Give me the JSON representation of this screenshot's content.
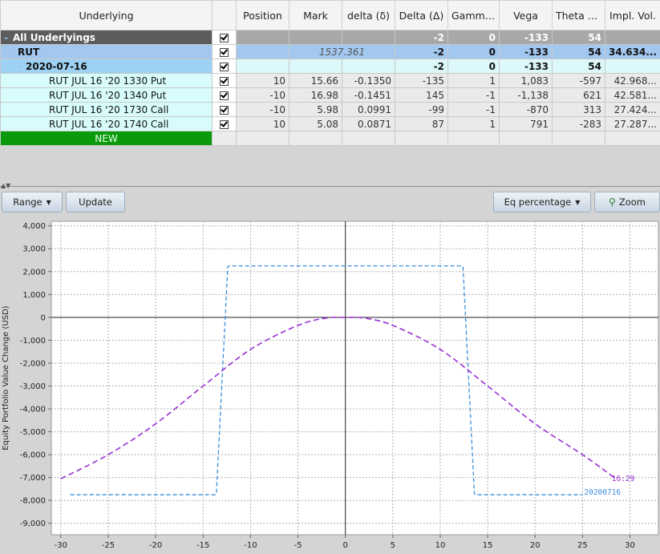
{
  "columns": [
    "Underlying",
    "",
    "Position",
    "Mark",
    "delta (δ)",
    "Delta (Δ)",
    "Gamma...",
    "Vega",
    "Theta (Θ)",
    "Impl. Vol."
  ],
  "all_row": {
    "label": "All Underlyings",
    "delta_cap": "-2",
    "gamma": "0",
    "vega": "-133",
    "theta": "54"
  },
  "rut_row": {
    "label": "RUT",
    "mark": "1537.361",
    "delta_cap": "-2",
    "gamma": "0",
    "vega": "-133",
    "theta": "54",
    "iv": "34.634..."
  },
  "date_row": {
    "label": "2020-07-16",
    "delta_cap": "-2",
    "gamma": "0",
    "vega": "-133",
    "theta": "54"
  },
  "legs": [
    {
      "name": "RUT JUL 16 '20 1330 Put",
      "position": "10",
      "mark": "15.66",
      "delta": "-0.1350",
      "delta_cap": "-135",
      "gamma": "1",
      "vega": "1,083",
      "theta": "-597",
      "iv": "42.968..."
    },
    {
      "name": "RUT JUL 16 '20 1340 Put",
      "position": "-10",
      "mark": "16.98",
      "delta": "-0.1451",
      "delta_cap": "145",
      "gamma": "-1",
      "vega": "-1,138",
      "theta": "621",
      "iv": "42.581..."
    },
    {
      "name": "RUT JUL 16 '20 1730 Call",
      "position": "-10",
      "mark": "5.98",
      "delta": "0.0991",
      "delta_cap": "-99",
      "gamma": "-1",
      "vega": "-870",
      "theta": "313",
      "iv": "27.424..."
    },
    {
      "name": "RUT JUL 16 '20 1740 Call",
      "position": "10",
      "mark": "5.08",
      "delta": "0.0871",
      "delta_cap": "87",
      "gamma": "1",
      "vega": "791",
      "theta": "-283",
      "iv": "27.287..."
    }
  ],
  "new_row_label": "NEW",
  "toolbar": {
    "range": "Range",
    "update": "Update",
    "eq": "Eq percentage",
    "zoom": "Zoom"
  },
  "chart_data": {
    "type": "line",
    "ylabel": "Equity Portfolio Value Change (USD)",
    "xlim": [
      -31,
      33
    ],
    "ylim": [
      -9500,
      4200
    ],
    "xticks": [
      -30,
      -25,
      -20,
      -15,
      -10,
      -5,
      0,
      5,
      10,
      15,
      20,
      25,
      30
    ],
    "yticks": [
      4000,
      3000,
      2000,
      1000,
      0,
      -1000,
      -2000,
      -3000,
      -4000,
      -5000,
      -6000,
      -7000,
      -8000,
      -9000
    ],
    "ytick_labels": [
      "4,000",
      "3,000",
      "2,000",
      "1,000",
      "0",
      "-1,000",
      "-2,000",
      "-3,000",
      "-4,000",
      "-5,000",
      "-6,000",
      "-7,000",
      "-8,000",
      "-9,000"
    ],
    "grid": true,
    "series": [
      {
        "name": "20200716",
        "color": "#3a8fdc",
        "dash": "dashed",
        "x": [
          -29,
          -13.7,
          -13.6,
          -12.4,
          -12.3,
          12.3,
          12.4,
          13.6,
          13.7,
          25
        ],
        "y": [
          -7750,
          -7750,
          -7700,
          2200,
          2250,
          2250,
          2200,
          -7700,
          -7750,
          -7750
        ]
      },
      {
        "name": "16:29",
        "color": "#9a2fd6",
        "dash": "dashed",
        "x": [
          -30,
          -25,
          -20,
          -15,
          -10,
          -5,
          -2,
          0,
          2,
          5,
          10,
          15,
          20,
          25,
          28.5
        ],
        "y": [
          -7050,
          -6000,
          -4650,
          -3000,
          -1400,
          -350,
          -30,
          0,
          -30,
          -350,
          -1400,
          -3000,
          -4650,
          -6000,
          -7050
        ]
      }
    ]
  }
}
